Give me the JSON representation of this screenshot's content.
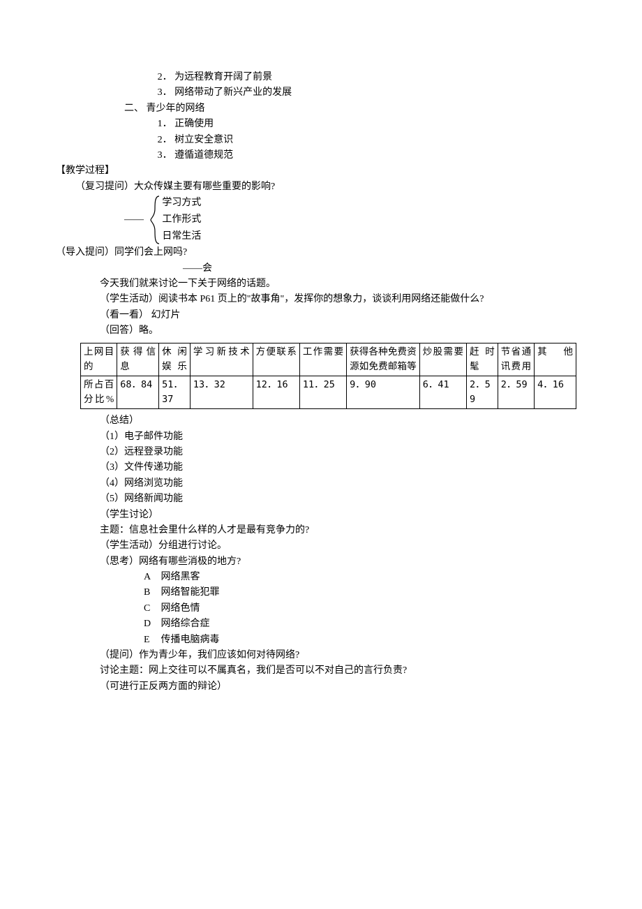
{
  "top": {
    "l1": "2． 为远程教育开阔了前景",
    "l2": "3． 网络带动了新兴产业的发展",
    "sec2": "二、 青少年的网络",
    "l3": "1． 正确使用",
    "l4": "2． 树立安全意识",
    "l5": "3． 遵循道德规范"
  },
  "process_hdr": "【教学过程】",
  "review_q": "（复习提问）大众传媒主要有哪些重要的影响?",
  "dash": "——",
  "brace": {
    "a": "学习方式",
    "b": "工作形式",
    "c": "日常生活"
  },
  "intro_q": "（导入提问）同学们会上网吗?",
  "intro_ans": "——会",
  "today": "今天我们就来讨论一下关于网络的话题。",
  "activity1": "（学生活动）阅读书本 P61 页上的\"故事角\"，发挥你的想象力，谈谈利用网络还能做什么?",
  "see": "（看一看）  幻灯片",
  "answer": "（回答）略。",
  "table": {
    "headers": [
      "上网目的",
      "获得信息",
      "休闲娱乐",
      "学习新技术",
      "方便联系",
      "工作需要",
      "获得各种免费资源如免费邮箱等",
      "炒股需要",
      "赶时髦",
      "节省通讯费用",
      "其他"
    ],
    "row2_label": "所占百分比%",
    "row2": [
      "68．84",
      "51．37",
      "13．32",
      "12．16",
      "11．25",
      "9．90",
      "6．41",
      "2．59",
      "2．59",
      "4．16"
    ]
  },
  "summary_hdr": "（总结）",
  "sum": {
    "s1": "（1）电子邮件功能",
    "s2": "（2）远程登录功能",
    "s3": "（3）文件传递功能",
    "s4": "（4）网络浏览功能",
    "s5": "（5）网络新闻功能"
  },
  "discuss_hdr": "（学生讨论）",
  "discuss_topic": "  主题：信息社会里什么样的人才是最有竞争力的?",
  "activity2": "（学生活动）分组进行讨论。",
  "think_hdr": "（思考）网络有哪些消极的地方?",
  "neg": {
    "a_lbl": "A",
    "a": "网络黑客",
    "b_lbl": "B",
    "b": "网络智能犯罪",
    "c_lbl": "C",
    "c": "网络色情",
    "d_lbl": "D",
    "d": "网络综合症",
    "e_lbl": "E",
    "e": "传播电脑病毒"
  },
  "ask_hdr": "（提问）作为青少年，我们应该如何对待网络?",
  "ask_topic": "  讨论主题：网上交往可以不属真名，我们是否可以不对自己的言行负责?",
  "debate": "（可进行正反两方面的辩论）",
  "chart_data": {
    "type": "table",
    "title": "",
    "columns": [
      "上网目的",
      "获得信息",
      "休闲娱乐",
      "学习新技术",
      "方便联系",
      "工作需要",
      "获得各种免费资源如免费邮箱等",
      "炒股需要",
      "赶时髦",
      "节省通讯费用",
      "其他"
    ],
    "rows": [
      {
        "label": "所占百分比%",
        "values": [
          68.84,
          51.37,
          13.32,
          12.16,
          11.25,
          9.9,
          6.41,
          2.59,
          2.59,
          4.16
        ]
      }
    ]
  }
}
